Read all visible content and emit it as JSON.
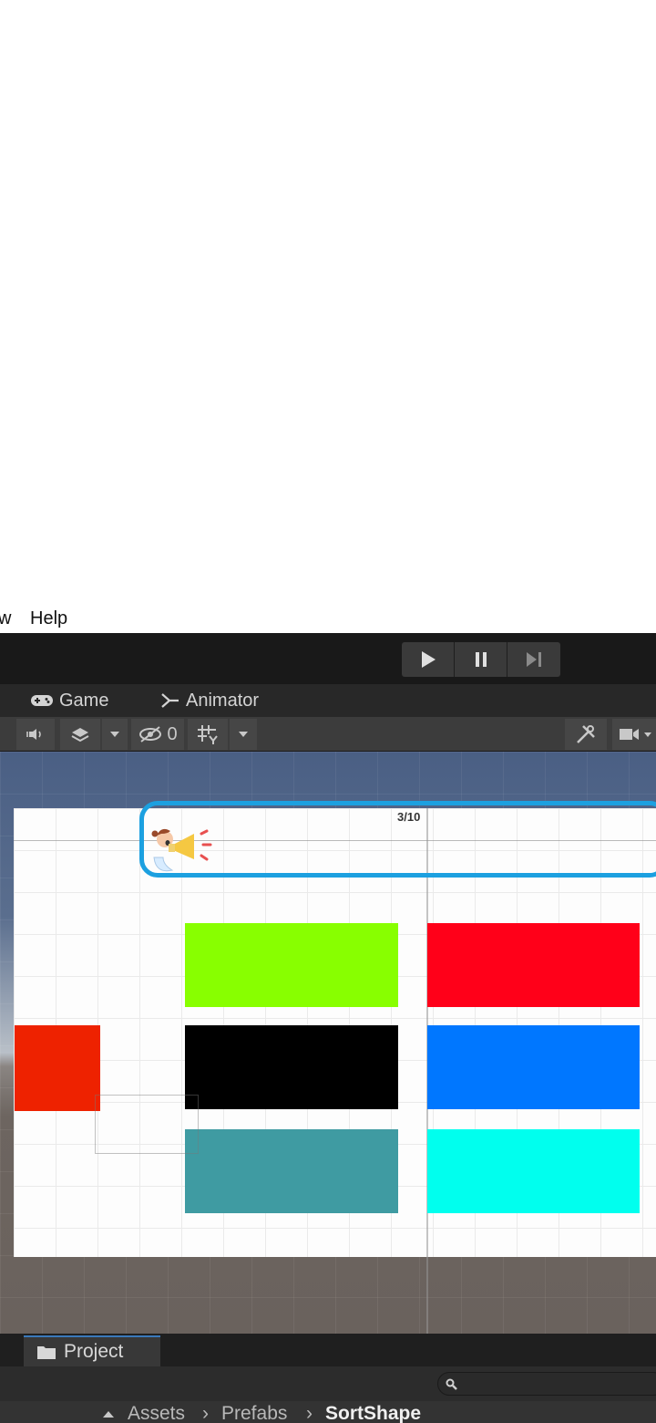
{
  "menu": {
    "partial_item": "w",
    "help": "Help"
  },
  "tabs": {
    "game": "Game",
    "animator": "Animator"
  },
  "game_toolbar": {
    "hidden_count": "0"
  },
  "scene": {
    "progress": "3/10",
    "colors": {
      "frame": "#1ca0e0"
    }
  },
  "shapes": [
    {
      "name": "green-rectangle",
      "color": "#88ff00"
    },
    {
      "name": "red-rectangle",
      "color": "#ff0019"
    },
    {
      "name": "black-rectangle",
      "color": "#000000"
    },
    {
      "name": "blue-rectangle",
      "color": "#0077ff"
    },
    {
      "name": "teal-rectangle",
      "color": "#3f9ba2"
    },
    {
      "name": "cyan-rectangle",
      "color": "#00ffee"
    },
    {
      "name": "dragged-red-square",
      "color": "#ee2200"
    }
  ],
  "project": {
    "tab": "Project",
    "breadcrumb": [
      "Assets",
      "Prefabs",
      "SortShape"
    ]
  }
}
